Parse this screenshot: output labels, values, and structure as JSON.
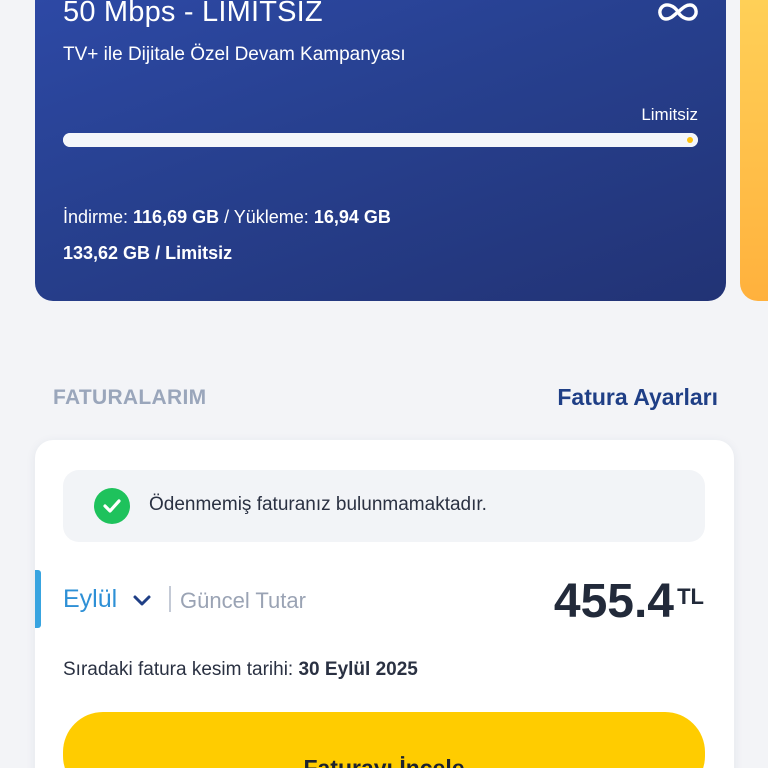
{
  "plan": {
    "title": "50 Mbps - LIMITSIZ",
    "subtitle": "TV+ ile Dijitale Özel Devam Kampanyası",
    "limit_label": "Limitsiz",
    "progress_fraction": 1.0,
    "download_label": "İndirme: ",
    "download_value": "116,69 GB",
    "separator": " / Yükleme: ",
    "upload_value": "16,94 GB",
    "total_used": "133,62 GB",
    "total_sep": " / ",
    "total_limit": "Limitsiz",
    "icon": "infinity-icon"
  },
  "bills": {
    "section_title": "FATURALARIM",
    "settings_link": "Fatura Ayarları",
    "notice": "Ödenmemiş faturanız bulunmamaktadır.",
    "notice_icon": "check-circle-icon",
    "month": "Eylül",
    "current_label": "Güncel Tutar",
    "amount": "455.4",
    "currency": "TL",
    "due_label": "Sıradaki fatura kesim tarihi: ",
    "due_date": "30 Eylül 2025",
    "cta_label": "Faturayı İncele"
  },
  "colors": {
    "plan_card": "#27408f",
    "accent_yellow": "#ffcc00",
    "link_blue": "#1f3f86",
    "month_blue": "#2e90d6",
    "success_green": "#1ec25c"
  }
}
